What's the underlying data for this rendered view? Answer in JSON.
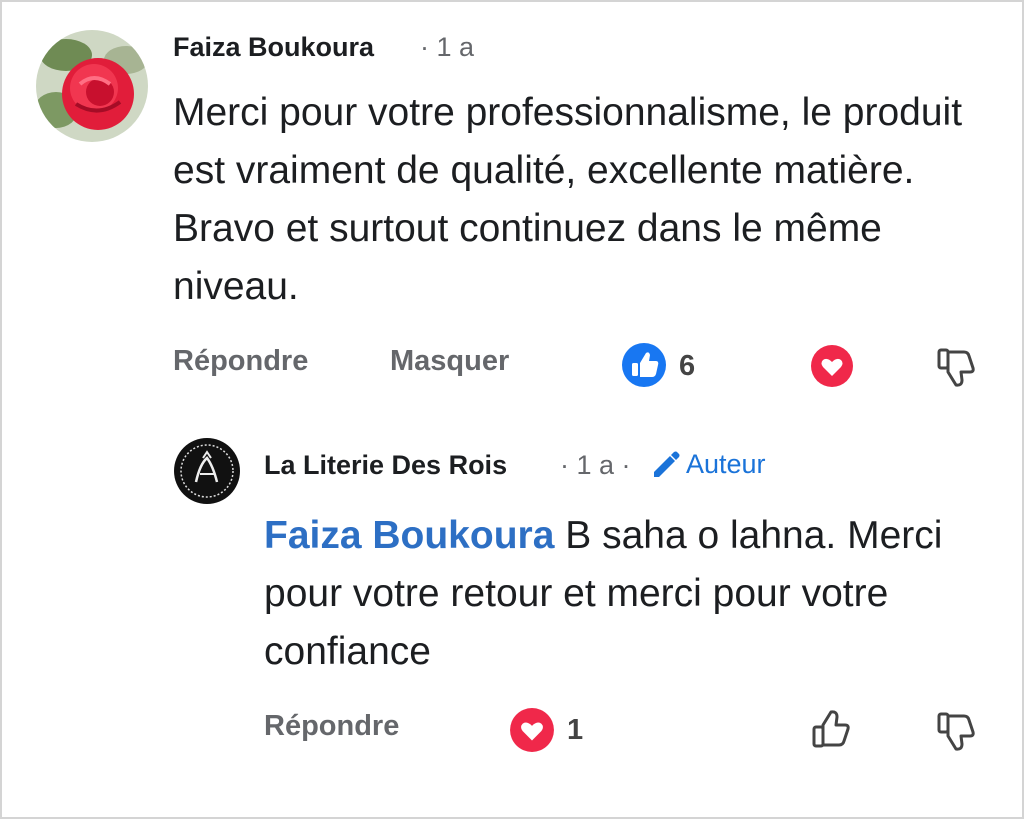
{
  "comment": {
    "author": "Faiza Boukoura",
    "time": "· 1 a",
    "text": "Merci pour votre professionnalisme, le produit est vraiment de qualité, excellente matière. Bravo et surtout continuez dans le même niveau.",
    "actions": {
      "reply": "Répondre",
      "hide": "Masquer"
    },
    "like_count": "6"
  },
  "reply": {
    "author": "La Literie Des Rois",
    "time": "· 1 a ·",
    "badge": "Auteur",
    "mention": "Faiza Boukoura",
    "text": " B saha o lahna. Merci pour votre retour et merci pour votre confiance",
    "actions": {
      "reply": "Répondre"
    },
    "love_count": "1"
  },
  "colors": {
    "like_blue": "#1877f2",
    "love_red": "#f0284a",
    "mention_blue": "#2d6fc4"
  }
}
